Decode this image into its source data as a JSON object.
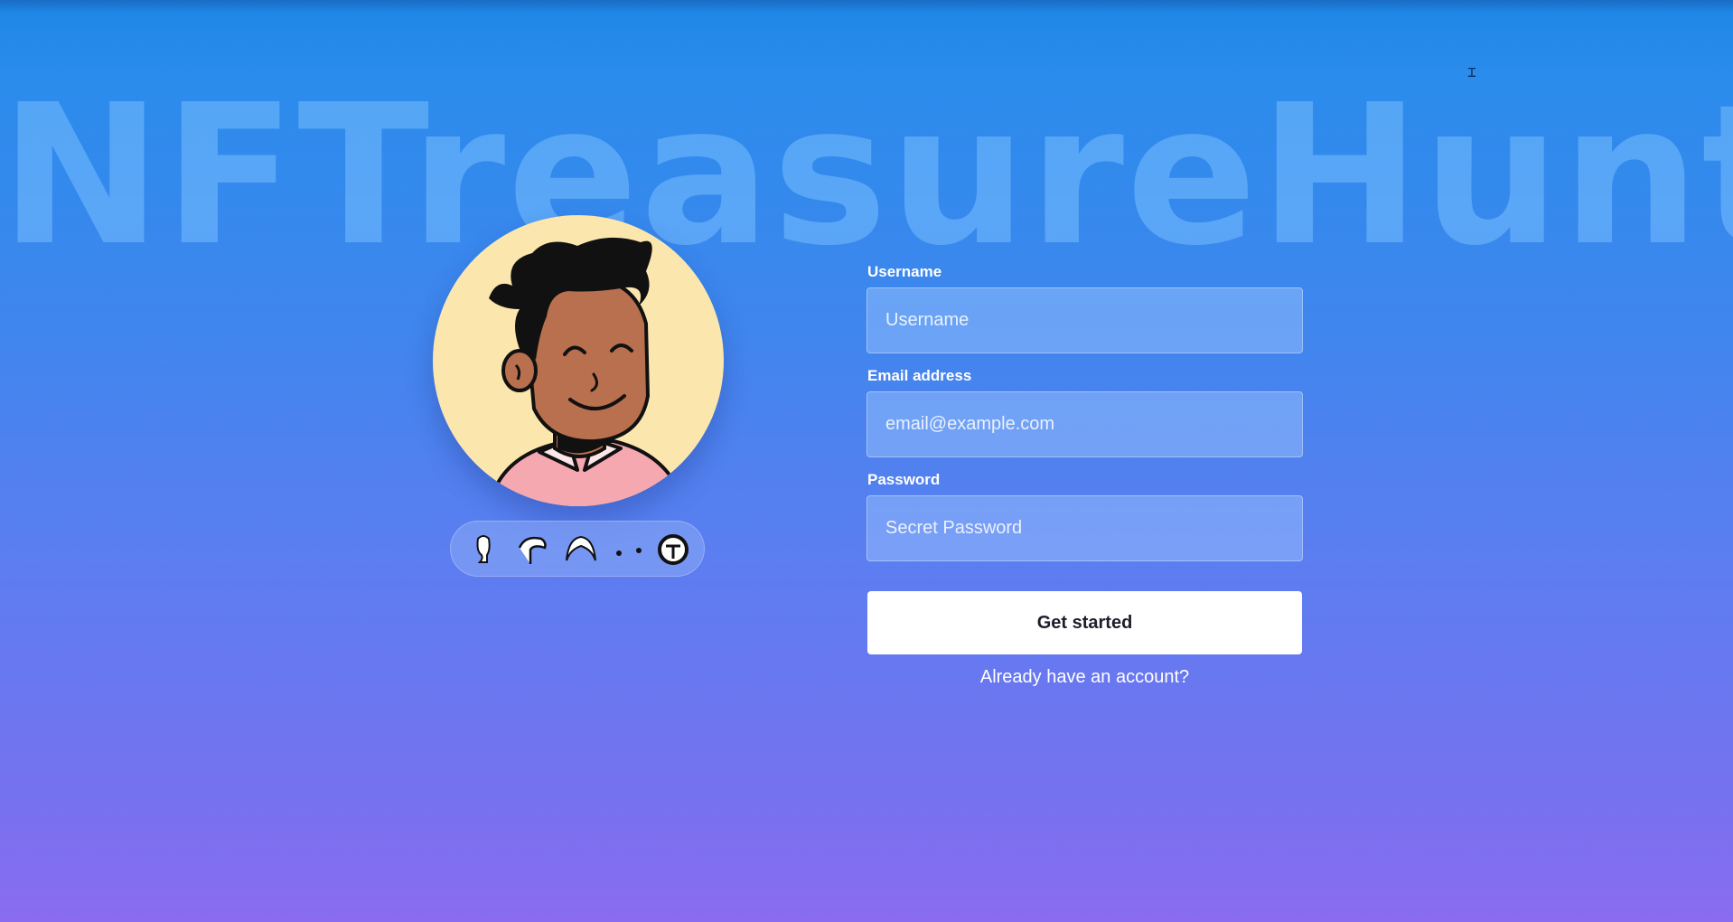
{
  "brand": {
    "name": "NFTreasureHunt"
  },
  "avatar": {
    "colors": {
      "background": "#fbe6ad",
      "skin": "#b8704e",
      "hair": "#111111",
      "shirt": "#f6a8b0"
    },
    "part_options": [
      {
        "icon": "head-shape-icon"
      },
      {
        "icon": "hair-side-icon"
      },
      {
        "icon": "hair-top-icon"
      },
      {
        "icon": "eyes-icon"
      },
      {
        "icon": "mouth-icon"
      }
    ]
  },
  "form": {
    "username": {
      "label": "Username",
      "placeholder": "Username"
    },
    "email": {
      "label": "Email address",
      "placeholder": "email@example.com"
    },
    "password": {
      "label": "Password",
      "placeholder": "Secret Password"
    },
    "submit_label": "Get started",
    "login_link": "Already have an account?"
  },
  "theme": {
    "gradient_top": "#1e86e6",
    "gradient_bottom": "#8a6cf0",
    "button_bg": "#ffffff"
  }
}
